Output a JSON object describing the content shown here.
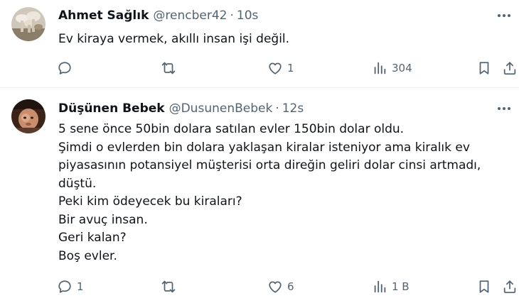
{
  "colors": {
    "text_primary": "#0f1419",
    "text_secondary": "#536471",
    "divider": "#eff3f4"
  },
  "tweets": [
    {
      "display_name": "Ahmet Sağlık",
      "handle": "@rencber42",
      "separator": "·",
      "time": "10s",
      "avatar_icon": "avatar-mushrooms-photo",
      "lines": [
        "Ev kiraya vermek, akıllı insan işi değil."
      ],
      "reply_count": "",
      "retweet_count": "",
      "like_count": "1",
      "view_count": "304"
    },
    {
      "display_name": "Düşünen Bebek",
      "handle": "@DusunenBebek",
      "separator": "·",
      "time": "12s",
      "avatar_icon": "avatar-baby-photo",
      "lines": [
        "5 sene önce 50bin dolara satılan evler 150bin dolar oldu.",
        "Şimdi o evlerden bin dolara yaklaşan kiralar isteniyor ama kiralık ev",
        "piyasasının potansiyel müşterisi orta direğin geliri dolar cinsi artmadı,",
        "düştü.",
        "Peki kim ödeyecek bu kiraları?",
        "Bir avuç insan.",
        "Geri kalan?",
        "Boş evler."
      ],
      "reply_count": "1",
      "retweet_count": "",
      "like_count": "6",
      "view_count": "1 B"
    }
  ]
}
